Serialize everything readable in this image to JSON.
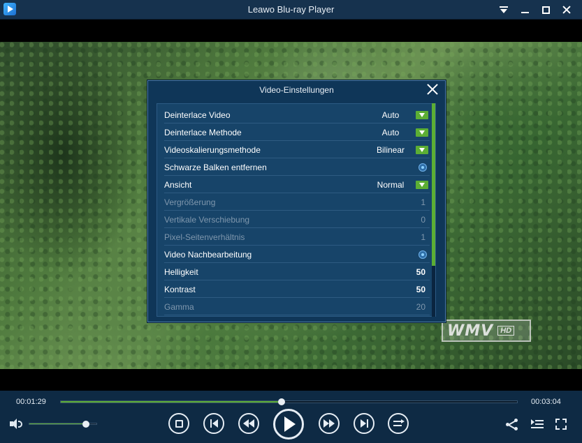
{
  "window": {
    "title": "Leawo Blu-ray Player"
  },
  "watermark": {
    "text": "WMV",
    "badge": "HD"
  },
  "dialog": {
    "title": "Video-Einstellungen",
    "rows": [
      {
        "label": "Deinterlace Video",
        "value": "Auto",
        "control": "dropdown",
        "enabled": true
      },
      {
        "label": "Deinterlace Methode",
        "value": "Auto",
        "control": "dropdown",
        "enabled": true
      },
      {
        "label": "Videoskalierungsmethode",
        "value": "Bilinear",
        "control": "dropdown",
        "enabled": true
      },
      {
        "label": "Schwarze Balken entfernen",
        "value": "",
        "control": "radio",
        "enabled": true
      },
      {
        "label": "Ansicht",
        "value": "Normal",
        "control": "dropdown",
        "enabled": true
      },
      {
        "label": "Vergrößerung",
        "value": "1",
        "control": "number",
        "enabled": false
      },
      {
        "label": "Vertikale Verschiebung",
        "value": "0",
        "control": "number",
        "enabled": false
      },
      {
        "label": "Pixel-Seitenverhältnis",
        "value": "1",
        "control": "number",
        "enabled": false
      },
      {
        "label": "Video Nachbearbeitung",
        "value": "",
        "control": "radio",
        "enabled": true
      },
      {
        "label": "Helligkeit",
        "value": "50",
        "control": "number",
        "enabled": true
      },
      {
        "label": "Kontrast",
        "value": "50",
        "control": "number",
        "enabled": true
      },
      {
        "label": "Gamma",
        "value": "20",
        "control": "number",
        "enabled": false
      }
    ],
    "scroll_fraction_visible": 0.76
  },
  "playback": {
    "elapsed": "00:01:29",
    "total": "00:03:04",
    "progress_fraction": 0.484,
    "volume_fraction": 0.84
  },
  "colors": {
    "accent": "#5cae34",
    "panel": "#0f3658",
    "titlebar": "#16324e"
  },
  "icons": {
    "controls": [
      "stop-icon",
      "previous-icon",
      "rewind-icon",
      "play-icon",
      "fast-forward-icon",
      "next-icon",
      "loop-icon"
    ],
    "right": [
      "share-icon",
      "playlist-icon",
      "fullscreen-icon"
    ]
  }
}
